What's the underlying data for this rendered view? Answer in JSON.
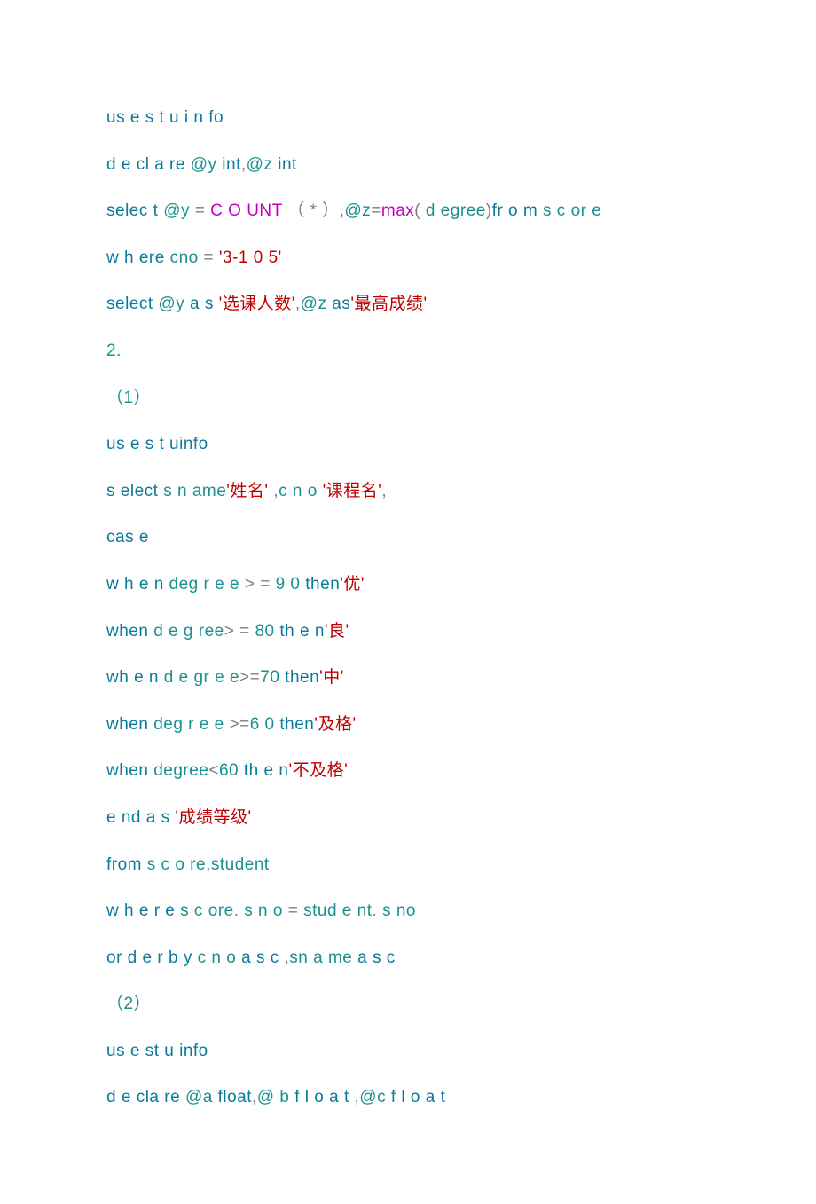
{
  "lines": [
    [
      {
        "t": "us e  s t u i n fo",
        "c": "kw"
      }
    ],
    [
      {
        "t": "d e cl a re ",
        "c": "kw"
      },
      {
        "t": "@y ",
        "c": "var"
      },
      {
        "t": "int",
        "c": "kw"
      },
      {
        "t": ",",
        "c": "punc"
      },
      {
        "t": "@z ",
        "c": "var"
      },
      {
        "t": "int",
        "c": "kw"
      }
    ],
    [
      {
        "t": "selec t   ",
        "c": "kw"
      },
      {
        "t": "@y ",
        "c": "var"
      },
      {
        "t": "= ",
        "c": "punc"
      },
      {
        "t": "C O UNT ",
        "c": "fn"
      },
      {
        "t": "（",
        "c": "punc"
      },
      {
        "t": " * ",
        "c": "punc"
      },
      {
        "t": "）",
        "c": "punc"
      },
      {
        "t": ",",
        "c": "punc"
      },
      {
        "t": "@z",
        "c": "var"
      },
      {
        "t": "=",
        "c": "punc"
      },
      {
        "t": "max",
        "c": "fn"
      },
      {
        "t": "( ",
        "c": "punc"
      },
      {
        "t": "d egree",
        "c": "id"
      },
      {
        "t": ")",
        "c": "punc"
      },
      {
        "t": "fr o m  ",
        "c": "kw"
      },
      {
        "t": "s c or e",
        "c": "id"
      }
    ],
    [
      {
        "t": "w h ere ",
        "c": "kw"
      },
      {
        "t": "cno ",
        "c": "id"
      },
      {
        "t": "= ",
        "c": "punc"
      },
      {
        "t": "'3-1 0 5'",
        "c": "str"
      }
    ],
    [
      {
        "t": "select ",
        "c": "kw"
      },
      {
        "t": "@y ",
        "c": "var"
      },
      {
        "t": "a s ",
        "c": "kw"
      },
      {
        "t": "'选课人数'",
        "c": "str"
      },
      {
        "t": ",",
        "c": "punc"
      },
      {
        "t": "@z ",
        "c": "var"
      },
      {
        "t": "as",
        "c": "kw"
      },
      {
        "t": "'最高成绩'",
        "c": "str"
      }
    ],
    [
      {
        "t": "2.",
        "c": "plain"
      }
    ],
    [
      {
        "t": "（1）",
        "c": "plain"
      }
    ],
    [
      {
        "t": "us e   s  t uinfo",
        "c": "kw"
      }
    ],
    [
      {
        "t": " s elect ",
        "c": "kw"
      },
      {
        "t": "s n ame",
        "c": "id"
      },
      {
        "t": "'姓名'",
        "c": "str"
      },
      {
        "t": "  ,",
        "c": "punc"
      },
      {
        "t": "c n o    ",
        "c": "id"
      },
      {
        "t": "'课程名'",
        "c": "str"
      },
      {
        "t": ",",
        "c": "punc"
      }
    ],
    [
      {
        "t": "cas e",
        "c": "kw"
      }
    ],
    [
      {
        "t": " w h e n ",
        "c": "kw"
      },
      {
        "t": "deg r e e ",
        "c": "id"
      },
      {
        "t": "> = ",
        "c": "op"
      },
      {
        "t": "9 0 ",
        "c": "num"
      },
      {
        "t": "then",
        "c": "kw"
      },
      {
        "t": "'优'",
        "c": "str"
      }
    ],
    [
      {
        "t": "when   ",
        "c": "kw"
      },
      {
        "t": "d e g ree",
        "c": "id"
      },
      {
        "t": "> = ",
        "c": "op"
      },
      {
        "t": "80 ",
        "c": "num"
      },
      {
        "t": "th e n",
        "c": "kw"
      },
      {
        "t": "'良'",
        "c": "str"
      }
    ],
    [
      {
        "t": "wh e n    ",
        "c": "kw"
      },
      {
        "t": "d e gr e e",
        "c": "id"
      },
      {
        "t": ">=",
        "c": "op"
      },
      {
        "t": "70 ",
        "c": "num"
      },
      {
        "t": "then",
        "c": "kw"
      },
      {
        "t": "'中'",
        "c": "str"
      }
    ],
    [
      {
        "t": "when ",
        "c": "kw"
      },
      {
        "t": "deg r e e ",
        "c": "id"
      },
      {
        "t": ">=",
        "c": "op"
      },
      {
        "t": "6 0   ",
        "c": "num"
      },
      {
        "t": "then",
        "c": "kw"
      },
      {
        "t": "'及格'",
        "c": "str"
      }
    ],
    [
      {
        "t": "when ",
        "c": "kw"
      },
      {
        "t": "degree",
        "c": "id"
      },
      {
        "t": "<",
        "c": "op"
      },
      {
        "t": "60    ",
        "c": "num"
      },
      {
        "t": "th e n",
        "c": "kw"
      },
      {
        "t": "'不及格'",
        "c": "str"
      }
    ],
    [
      {
        "t": " e nd  a s ",
        "c": "kw"
      },
      {
        "t": "'成绩等级'",
        "c": "str"
      }
    ],
    [
      {
        "t": "from  ",
        "c": "kw"
      },
      {
        "t": "s c o re",
        "c": "id"
      },
      {
        "t": ",",
        "c": "punc"
      },
      {
        "t": "student",
        "c": "id"
      }
    ],
    [
      {
        "t": " w h e r e   ",
        "c": "kw"
      },
      {
        "t": "s c ore",
        "c": "id"
      },
      {
        "t": ".  ",
        "c": "punc"
      },
      {
        "t": "s n o ",
        "c": "id"
      },
      {
        "t": "= ",
        "c": "punc"
      },
      {
        "t": "stud e nt",
        "c": "id"
      },
      {
        "t": ".  ",
        "c": "punc"
      },
      {
        "t": "s no",
        "c": "id"
      }
    ],
    [
      {
        "t": "or d e r  b y ",
        "c": "kw"
      },
      {
        "t": "c n o   ",
        "c": "id"
      },
      {
        "t": "a s c ",
        "c": "kw"
      },
      {
        "t": ",",
        "c": "punc"
      },
      {
        "t": "sn a me ",
        "c": "id"
      },
      {
        "t": "a s c",
        "c": "kw"
      }
    ],
    [
      {
        "t": "（2）",
        "c": "plain"
      }
    ],
    [
      {
        "t": "us e  st u info",
        "c": "kw"
      }
    ],
    [
      {
        "t": " d e cla re   ",
        "c": "kw"
      },
      {
        "t": "@a   ",
        "c": "var"
      },
      {
        "t": "float",
        "c": "kw"
      },
      {
        "t": ",",
        "c": "punc"
      },
      {
        "t": "@ b   ",
        "c": "var"
      },
      {
        "t": "f l o a t ",
        "c": "kw"
      },
      {
        "t": ",",
        "c": "punc"
      },
      {
        "t": "@c  ",
        "c": "var"
      },
      {
        "t": "f l o a t",
        "c": "kw"
      }
    ]
  ]
}
